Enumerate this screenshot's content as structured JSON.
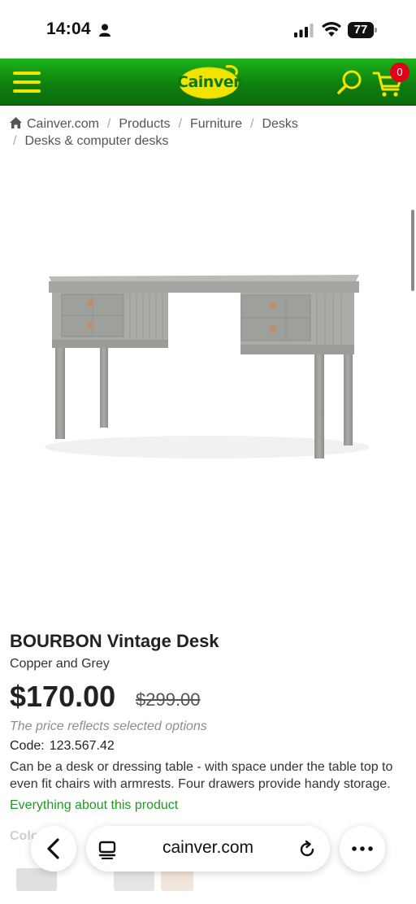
{
  "status_bar": {
    "time": "14:04",
    "battery": "77"
  },
  "header": {
    "logo_text": "Cainver",
    "cart_count": "0",
    "colors": {
      "bar": "#0d7d0e",
      "accent": "#f3e300",
      "badge": "#e3001b"
    }
  },
  "breadcrumb": {
    "items": [
      {
        "label": "Cainver.com"
      },
      {
        "label": "Products"
      },
      {
        "label": "Furniture"
      },
      {
        "label": "Desks"
      },
      {
        "label": "Desks & computer desks"
      }
    ]
  },
  "product": {
    "title": "BOURBON Vintage Desk",
    "variant": "Copper and Grey",
    "price": "$170.00",
    "old_price": "$299.00",
    "price_note": "The price reflects selected options",
    "code_label": "Code:",
    "code_value": "123.567.42",
    "description": "Can be a desk or dressing table - with space under the table top to even fit chairs with armrests. Four drawers provide handy storage.",
    "more_link": "Everything about this product",
    "color_label": "Colo",
    "link_color": "#1f9a22"
  },
  "browser": {
    "address": "cainver.com"
  }
}
